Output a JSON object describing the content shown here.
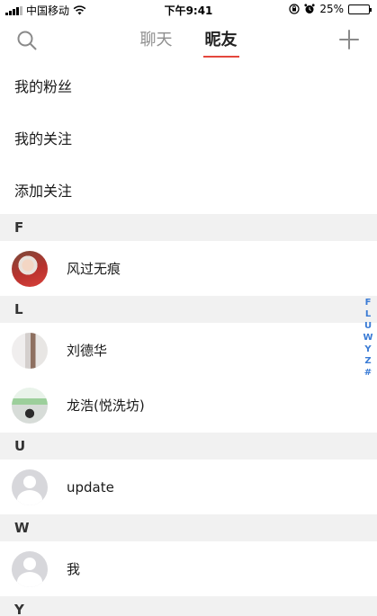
{
  "status_bar": {
    "carrier": "中国移动",
    "time": "下午9:41",
    "battery": "25%",
    "battery_level": 0.25
  },
  "nav": {
    "tabs": [
      {
        "label": "聊天",
        "active": false
      },
      {
        "label": "昵友",
        "active": true
      }
    ],
    "left_icon": "search-icon",
    "right_icon": "plus-icon",
    "accent_color": "#e4473d"
  },
  "menu": [
    {
      "label": "我的粉丝"
    },
    {
      "label": "我的关注"
    },
    {
      "label": "添加关注"
    }
  ],
  "sections": [
    {
      "letter": "F",
      "contacts": [
        {
          "name": "风过无痕",
          "avatar": "photo"
        }
      ]
    },
    {
      "letter": "L",
      "contacts": [
        {
          "name": "刘德华",
          "avatar": "photo"
        },
        {
          "name": "龙浩(悦洗坊)",
          "avatar": "photo"
        }
      ]
    },
    {
      "letter": "U",
      "contacts": [
        {
          "name": "update",
          "avatar": "default"
        }
      ]
    },
    {
      "letter": "W",
      "contacts": [
        {
          "name": "我",
          "avatar": "default"
        }
      ]
    },
    {
      "letter": "Y",
      "contacts": []
    }
  ],
  "index_bar": [
    "F",
    "L",
    "U",
    "W",
    "Y",
    "Z",
    "#"
  ]
}
